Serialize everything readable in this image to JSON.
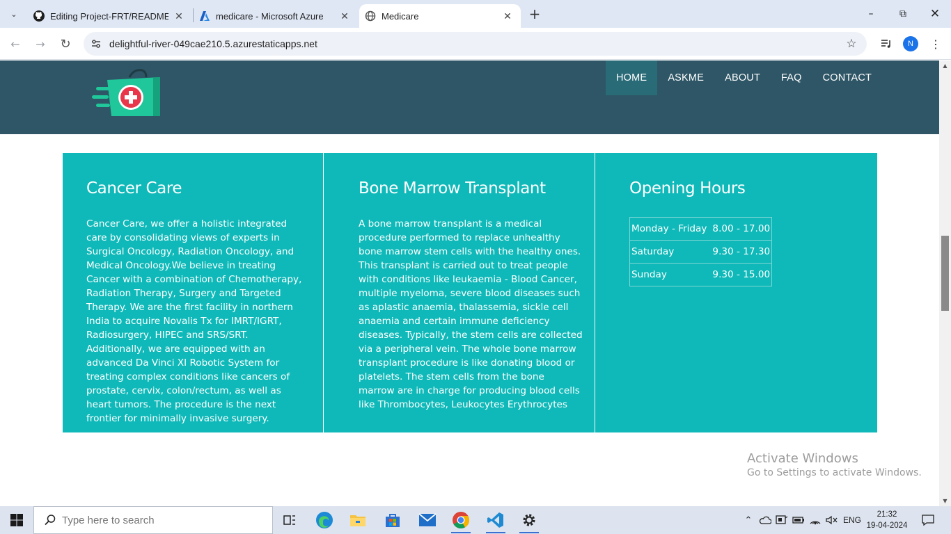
{
  "browser": {
    "tabs": [
      {
        "title": "Editing Project-FRT/README.m",
        "favicon": "github-icon"
      },
      {
        "title": "medicare - Microsoft Azure",
        "favicon": "azure-icon"
      },
      {
        "title": "Medicare",
        "favicon": "globe-icon"
      }
    ],
    "url": "delightful-river-049cae210.5.azurestaticapps.net",
    "profile_initial": "N"
  },
  "site": {
    "nav": [
      {
        "label": "HOME",
        "active": true
      },
      {
        "label": "ASKME",
        "active": false
      },
      {
        "label": "ABOUT",
        "active": false
      },
      {
        "label": "FAQ",
        "active": false
      },
      {
        "label": "CONTACT",
        "active": false
      }
    ],
    "cards": [
      {
        "title": "Cancer Care",
        "body": "Cancer Care, we offer a holistic integrated care by consolidating views of experts in Surgical Oncology, Radiation Oncology, and Medical Oncology.We believe in treating Cancer with a combination of Chemotherapy, Radiation Therapy, Surgery and Targeted Therapy. We are the first facility in northern India to acquire Novalis Tx for IMRT/IGRT, Radiosurgery, HIPEC and SRS/SRT. Additionally, we are equipped with an advanced Da Vinci XI Robotic System for treating complex conditions like cancers of prostate, cervix, colon/rectum, as well as heart tumors. The procedure is the next frontier for minimally invasive surgery."
      },
      {
        "title": "Bone Marrow Transplant",
        "body": "A bone marrow transplant is a medical procedure performed to replace unhealthy bone marrow stem cells with the healthy ones. This transplant is carried out to treat people with conditions like leukaemia - Blood Cancer, multiple myeloma, severe blood diseases such as aplastic anaemia, thalassemia, sickle cell anaemia and certain immune deficiency diseases. Typically, the stem cells are collected via a peripheral vein. The whole bone marrow transplant procedure is like donating blood or platelets. The stem cells from the bone marrow are in charge for producing blood cells like Thrombocytes, Leukocytes Erythrocytes"
      },
      {
        "title": "Opening Hours",
        "hours": [
          {
            "day": "Monday - Friday",
            "time": "8.00 - 17.00"
          },
          {
            "day": "Saturday",
            "time": "9.30 - 17.30"
          },
          {
            "day": "Sunday",
            "time": "9.30 - 15.00"
          }
        ]
      }
    ],
    "colors": {
      "header": "#2e5666",
      "card": "#0fb9b9",
      "nav_active": "#2a6b78"
    }
  },
  "watermark": {
    "line1": "Activate Windows",
    "line2": "Go to Settings to activate Windows."
  },
  "taskbar": {
    "search_placeholder": "Type here to search",
    "language": "ENG",
    "time": "21:32",
    "date": "19-04-2024"
  }
}
